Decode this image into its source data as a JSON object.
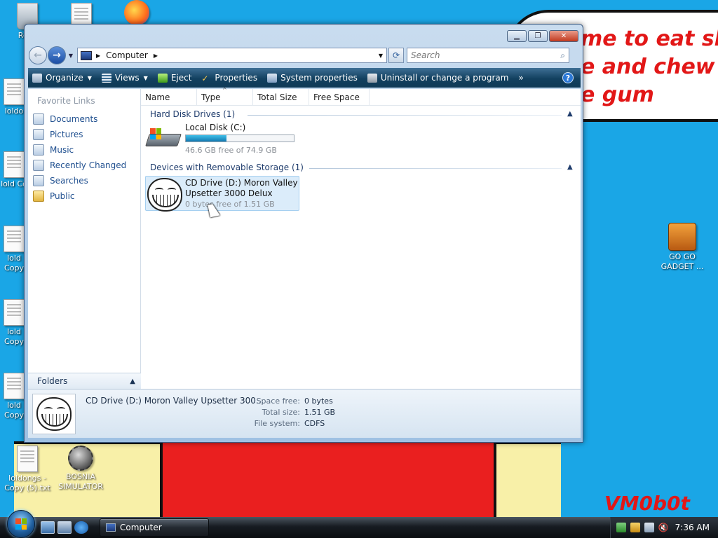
{
  "desktop": {
    "bubble_text": "me to eat shit\ne and chew\ne gum",
    "signature": "VM0b0t",
    "icons": [
      {
        "label": "Recy"
      },
      {
        "label": "loldo"
      },
      {
        "label": "lold Co"
      },
      {
        "label": "lold Copy"
      },
      {
        "label": "lold Copy"
      },
      {
        "label": "lold Copy"
      },
      {
        "label": "loldongs - Copy (5).txt"
      },
      {
        "label": "BOSNIA SIMULATOR"
      },
      {
        "label": "GO GO GADGET ..."
      }
    ]
  },
  "window": {
    "address": {
      "location": "Computer"
    },
    "search": {
      "placeholder": "Search"
    },
    "toolbar": {
      "organize": "Organize",
      "views": "Views",
      "eject": "Eject",
      "properties": "Properties",
      "system_properties": "System properties",
      "uninstall": "Uninstall or change a program",
      "more": "»",
      "help": "?"
    },
    "nav_pane": {
      "title": "Favorite Links",
      "links": [
        "Documents",
        "Pictures",
        "Music",
        "Recently Changed",
        "Searches",
        "Public"
      ],
      "folders": "Folders"
    },
    "columns": [
      "Name",
      "Type",
      "Total Size",
      "Free Space"
    ],
    "groups": {
      "hard_disk": {
        "header": "Hard Disk Drives (1)",
        "drive_name": "Local Disk (C:)",
        "free_text": "46.6 GB free of 74.9 GB",
        "used_fraction": 0.378
      },
      "removable": {
        "header": "Devices with Removable Storage (1)",
        "drive_name_line1": "CD Drive (D:) Moron Valley",
        "drive_name_line2": "Upsetter 3000 Delux",
        "free_text": "0 bytes free of 1.51 GB"
      }
    },
    "details": {
      "title": "CD Drive (D:) Moron Valley Upsetter 300...",
      "space_free_label": "Space free:",
      "space_free": "0 bytes",
      "total_size_label": "Total size:",
      "total_size": "1.51 GB",
      "file_system_label": "File system:",
      "file_system": "CDFS"
    }
  },
  "taskbar": {
    "task_label": "Computer",
    "clock": "7:36 AM"
  },
  "colors": {
    "desktop": "#1aa6e6",
    "toolbar": "#12405f",
    "bubble_text": "#e21717",
    "link": "#1f4f8f"
  }
}
